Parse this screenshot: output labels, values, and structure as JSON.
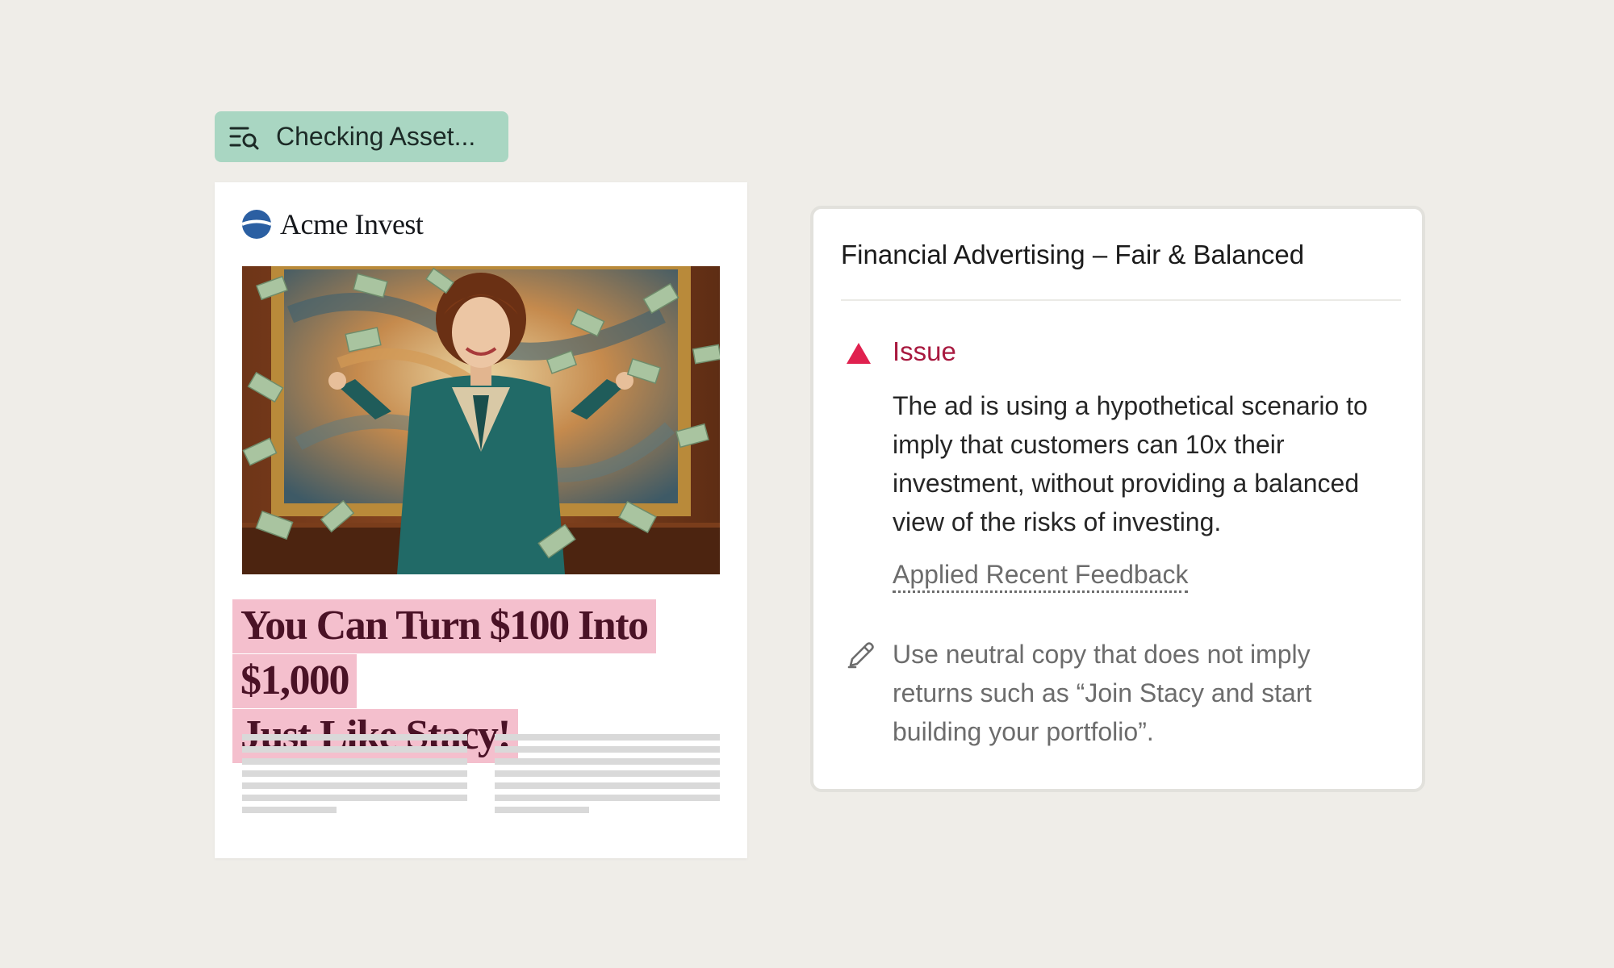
{
  "status": {
    "label": "Checking Asset..."
  },
  "ad": {
    "brand": "Acme Invest",
    "headline_line1": "You Can Turn $100 Into $1,000",
    "headline_line2": "Just Like Stacy!"
  },
  "review": {
    "title": "Financial Advertising – Fair & Balanced",
    "issue_label": "Issue",
    "issue_body": "The ad is using a hypothetical scenario to imply that customers can 10x their investment, without providing a balanced view of the risks of investing.",
    "feedback_link": "Applied Recent Feedback",
    "suggestion": "Use neutral copy that does not imply returns such as “Join Stacy and start building your portfolio”."
  },
  "colors": {
    "background": "#efede8",
    "status_pill": "#a9d6c2",
    "headline_highlight": "#f4bfcd",
    "headline_text": "#4a1226",
    "issue_red": "#a8193f",
    "issue_icon_red": "#e0214f",
    "brand_blue": "#2b5fa2"
  },
  "icons": {
    "status": "search-list-icon",
    "brand": "acme-logo-icon",
    "issue": "warning-triangle-icon",
    "suggestion": "pencil-icon"
  }
}
